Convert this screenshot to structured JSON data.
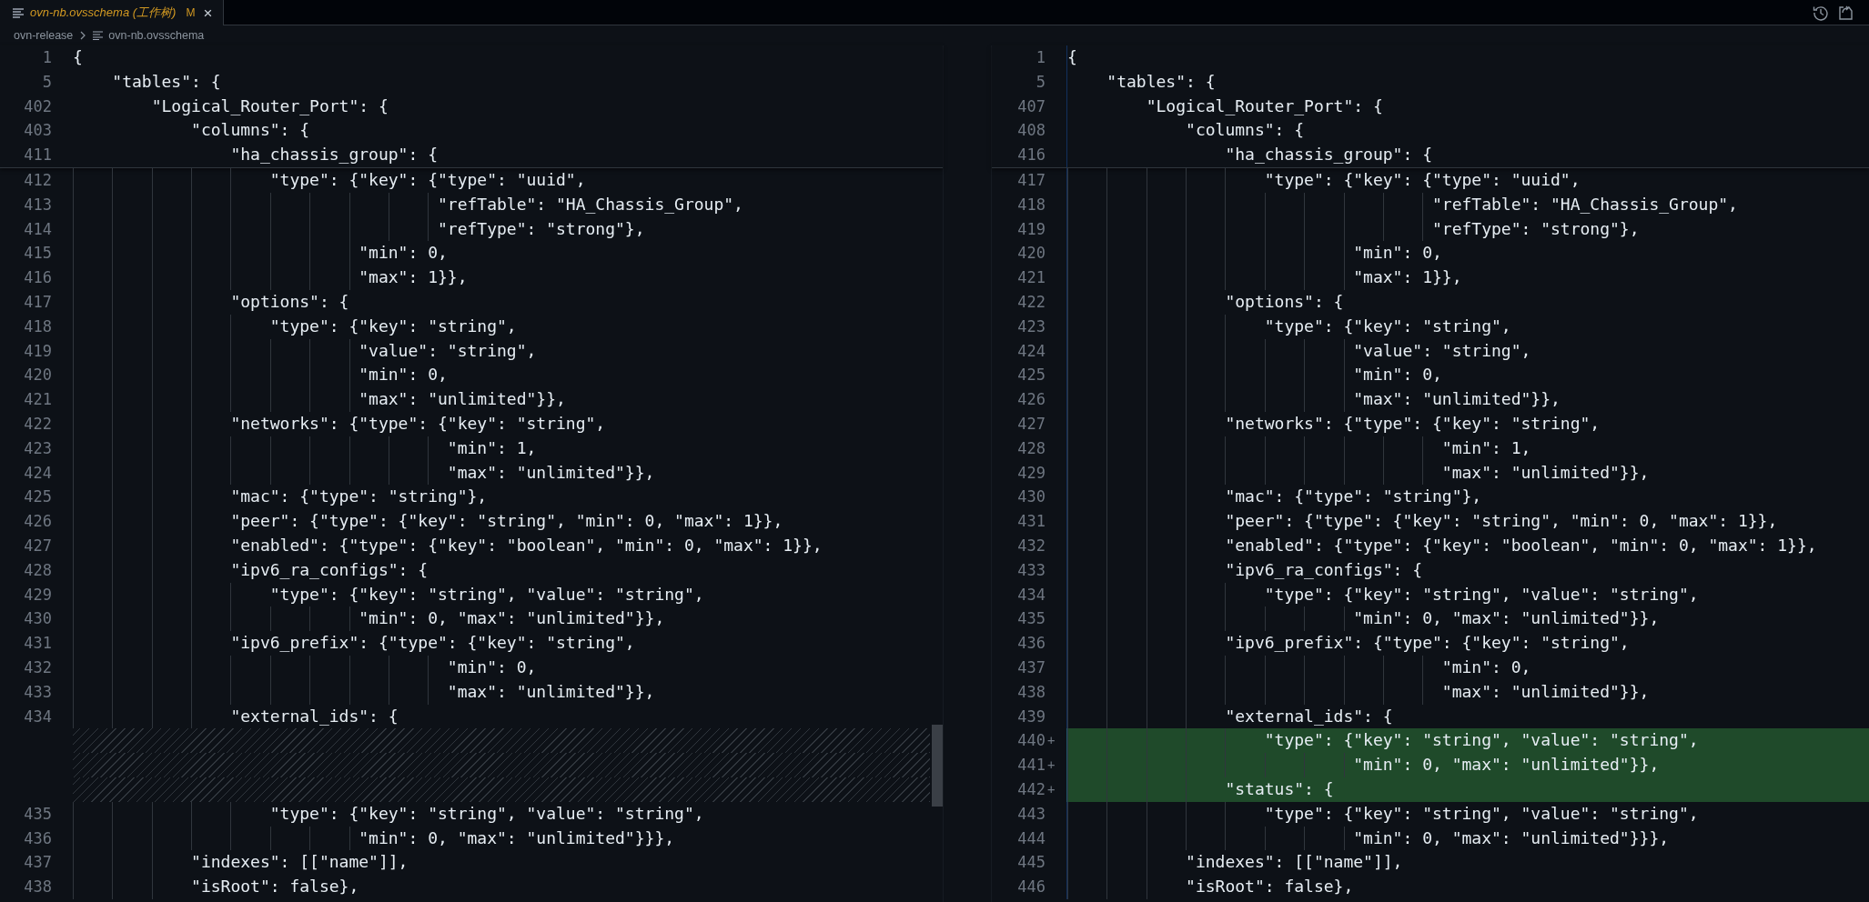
{
  "tab": {
    "title": "ovn-nb.ovsschema (工作树)",
    "badge": "M",
    "close": "×",
    "selected": true
  },
  "breadcrumb": [
    "ovn-release",
    "ovn-nb.ovsschema"
  ],
  "panes": [
    {
      "sticky": [
        {
          "number": "1",
          "text": "{"
        },
        {
          "number": "5",
          "text": "    \"tables\": {"
        },
        {
          "number": "402",
          "text": "        \"Logical_Router_Port\": {"
        },
        {
          "number": "403",
          "text": "            \"columns\": {"
        },
        {
          "number": "411",
          "text": "                \"ha_chassis_group\": {"
        }
      ],
      "lines": [
        {
          "kind": "normal",
          "number": "412",
          "text": "                    \"type\": {\"key\": {\"type\": \"uuid\","
        },
        {
          "kind": "normal",
          "number": "413",
          "text": "                                     \"refTable\": \"HA_Chassis_Group\","
        },
        {
          "kind": "normal",
          "number": "414",
          "text": "                                     \"refType\": \"strong\"},"
        },
        {
          "kind": "normal",
          "number": "415",
          "text": "                             \"min\": 0,"
        },
        {
          "kind": "normal",
          "number": "416",
          "text": "                             \"max\": 1}},"
        },
        {
          "kind": "normal",
          "number": "417",
          "text": "                \"options\": {"
        },
        {
          "kind": "normal",
          "number": "418",
          "text": "                    \"type\": {\"key\": \"string\","
        },
        {
          "kind": "normal",
          "number": "419",
          "text": "                             \"value\": \"string\","
        },
        {
          "kind": "normal",
          "number": "420",
          "text": "                             \"min\": 0,"
        },
        {
          "kind": "normal",
          "number": "421",
          "text": "                             \"max\": \"unlimited\"}},"
        },
        {
          "kind": "normal",
          "number": "422",
          "text": "                \"networks\": {\"type\": {\"key\": \"string\","
        },
        {
          "kind": "normal",
          "number": "423",
          "text": "                                      \"min\": 1,"
        },
        {
          "kind": "normal",
          "number": "424",
          "text": "                                      \"max\": \"unlimited\"}},"
        },
        {
          "kind": "normal",
          "number": "425",
          "text": "                \"mac\": {\"type\": \"string\"},"
        },
        {
          "kind": "normal",
          "number": "426",
          "text": "                \"peer\": {\"type\": {\"key\": \"string\", \"min\": 0, \"max\": 1}},"
        },
        {
          "kind": "normal",
          "number": "427",
          "text": "                \"enabled\": {\"type\": {\"key\": \"boolean\", \"min\": 0, \"max\": 1}},"
        },
        {
          "kind": "normal",
          "number": "428",
          "text": "                \"ipv6_ra_configs\": {"
        },
        {
          "kind": "normal",
          "number": "429",
          "text": "                    \"type\": {\"key\": \"string\", \"value\": \"string\","
        },
        {
          "kind": "normal",
          "number": "430",
          "text": "                             \"min\": 0, \"max\": \"unlimited\"}},"
        },
        {
          "kind": "normal",
          "number": "431",
          "text": "                \"ipv6_prefix\": {\"type\": {\"key\": \"string\","
        },
        {
          "kind": "normal",
          "number": "432",
          "text": "                                      \"min\": 0,"
        },
        {
          "kind": "normal",
          "number": "433",
          "text": "                                      \"max\": \"unlimited\"}},"
        },
        {
          "kind": "normal",
          "number": "434",
          "text": "                \"external_ids\": {"
        },
        {
          "kind": "filler"
        },
        {
          "kind": "filler"
        },
        {
          "kind": "filler"
        },
        {
          "kind": "normal",
          "number": "435",
          "text": "                    \"type\": {\"key\": \"string\", \"value\": \"string\","
        },
        {
          "kind": "normal",
          "number": "436",
          "text": "                             \"min\": 0, \"max\": \"unlimited\"}}},"
        },
        {
          "kind": "normal",
          "number": "437",
          "text": "            \"indexes\": [[\"name\"]],"
        },
        {
          "kind": "normal",
          "number": "438",
          "text": "            \"isRoot\": false},"
        }
      ]
    },
    {
      "sticky": [
        {
          "number": "1",
          "text": "{"
        },
        {
          "number": "5",
          "text": "    \"tables\": {"
        },
        {
          "number": "407",
          "text": "        \"Logical_Router_Port\": {"
        },
        {
          "number": "408",
          "text": "            \"columns\": {"
        },
        {
          "number": "416",
          "text": "                \"ha_chassis_group\": {"
        }
      ],
      "lines": [
        {
          "kind": "normal",
          "number": "417",
          "text": "                    \"type\": {\"key\": {\"type\": \"uuid\","
        },
        {
          "kind": "normal",
          "number": "418",
          "text": "                                     \"refTable\": \"HA_Chassis_Group\","
        },
        {
          "kind": "normal",
          "number": "419",
          "text": "                                     \"refType\": \"strong\"},"
        },
        {
          "kind": "normal",
          "number": "420",
          "text": "                             \"min\": 0,"
        },
        {
          "kind": "normal",
          "number": "421",
          "text": "                             \"max\": 1}},"
        },
        {
          "kind": "normal",
          "number": "422",
          "text": "                \"options\": {"
        },
        {
          "kind": "normal",
          "number": "423",
          "text": "                    \"type\": {\"key\": \"string\","
        },
        {
          "kind": "normal",
          "number": "424",
          "text": "                             \"value\": \"string\","
        },
        {
          "kind": "normal",
          "number": "425",
          "text": "                             \"min\": 0,"
        },
        {
          "kind": "normal",
          "number": "426",
          "text": "                             \"max\": \"unlimited\"}},"
        },
        {
          "kind": "normal",
          "number": "427",
          "text": "                \"networks\": {\"type\": {\"key\": \"string\","
        },
        {
          "kind": "normal",
          "number": "428",
          "text": "                                      \"min\": 1,"
        },
        {
          "kind": "normal",
          "number": "429",
          "text": "                                      \"max\": \"unlimited\"}},"
        },
        {
          "kind": "normal",
          "number": "430",
          "text": "                \"mac\": {\"type\": \"string\"},"
        },
        {
          "kind": "normal",
          "number": "431",
          "text": "                \"peer\": {\"type\": {\"key\": \"string\", \"min\": 0, \"max\": 1}},"
        },
        {
          "kind": "normal",
          "number": "432",
          "text": "                \"enabled\": {\"type\": {\"key\": \"boolean\", \"min\": 0, \"max\": 1}},"
        },
        {
          "kind": "normal",
          "number": "433",
          "text": "                \"ipv6_ra_configs\": {"
        },
        {
          "kind": "normal",
          "number": "434",
          "text": "                    \"type\": {\"key\": \"string\", \"value\": \"string\","
        },
        {
          "kind": "normal",
          "number": "435",
          "text": "                             \"min\": 0, \"max\": \"unlimited\"}},"
        },
        {
          "kind": "normal",
          "number": "436",
          "text": "                \"ipv6_prefix\": {\"type\": {\"key\": \"string\","
        },
        {
          "kind": "normal",
          "number": "437",
          "text": "                                      \"min\": 0,"
        },
        {
          "kind": "normal",
          "number": "438",
          "text": "                                      \"max\": \"unlimited\"}},"
        },
        {
          "kind": "normal",
          "number": "439",
          "text": "                \"external_ids\": {"
        },
        {
          "kind": "added",
          "number": "440",
          "marker": "+",
          "text": "                    \"type\": {\"key\": \"string\", \"value\": \"string\","
        },
        {
          "kind": "added",
          "number": "441",
          "marker": "+",
          "text": "                             \"min\": 0, \"max\": \"unlimited\"}},"
        },
        {
          "kind": "added",
          "number": "442",
          "marker": "+",
          "text": "                \"status\": {"
        },
        {
          "kind": "normal",
          "number": "443",
          "text": "                    \"type\": {\"key\": \"string\", \"value\": \"string\","
        },
        {
          "kind": "normal",
          "number": "444",
          "text": "                             \"min\": 0, \"max\": \"unlimited\"}}},"
        },
        {
          "kind": "normal",
          "number": "445",
          "text": "            \"indexes\": [[\"name\"]],"
        },
        {
          "kind": "normal",
          "number": "446",
          "text": "            \"isRoot\": false},"
        }
      ]
    }
  ]
}
